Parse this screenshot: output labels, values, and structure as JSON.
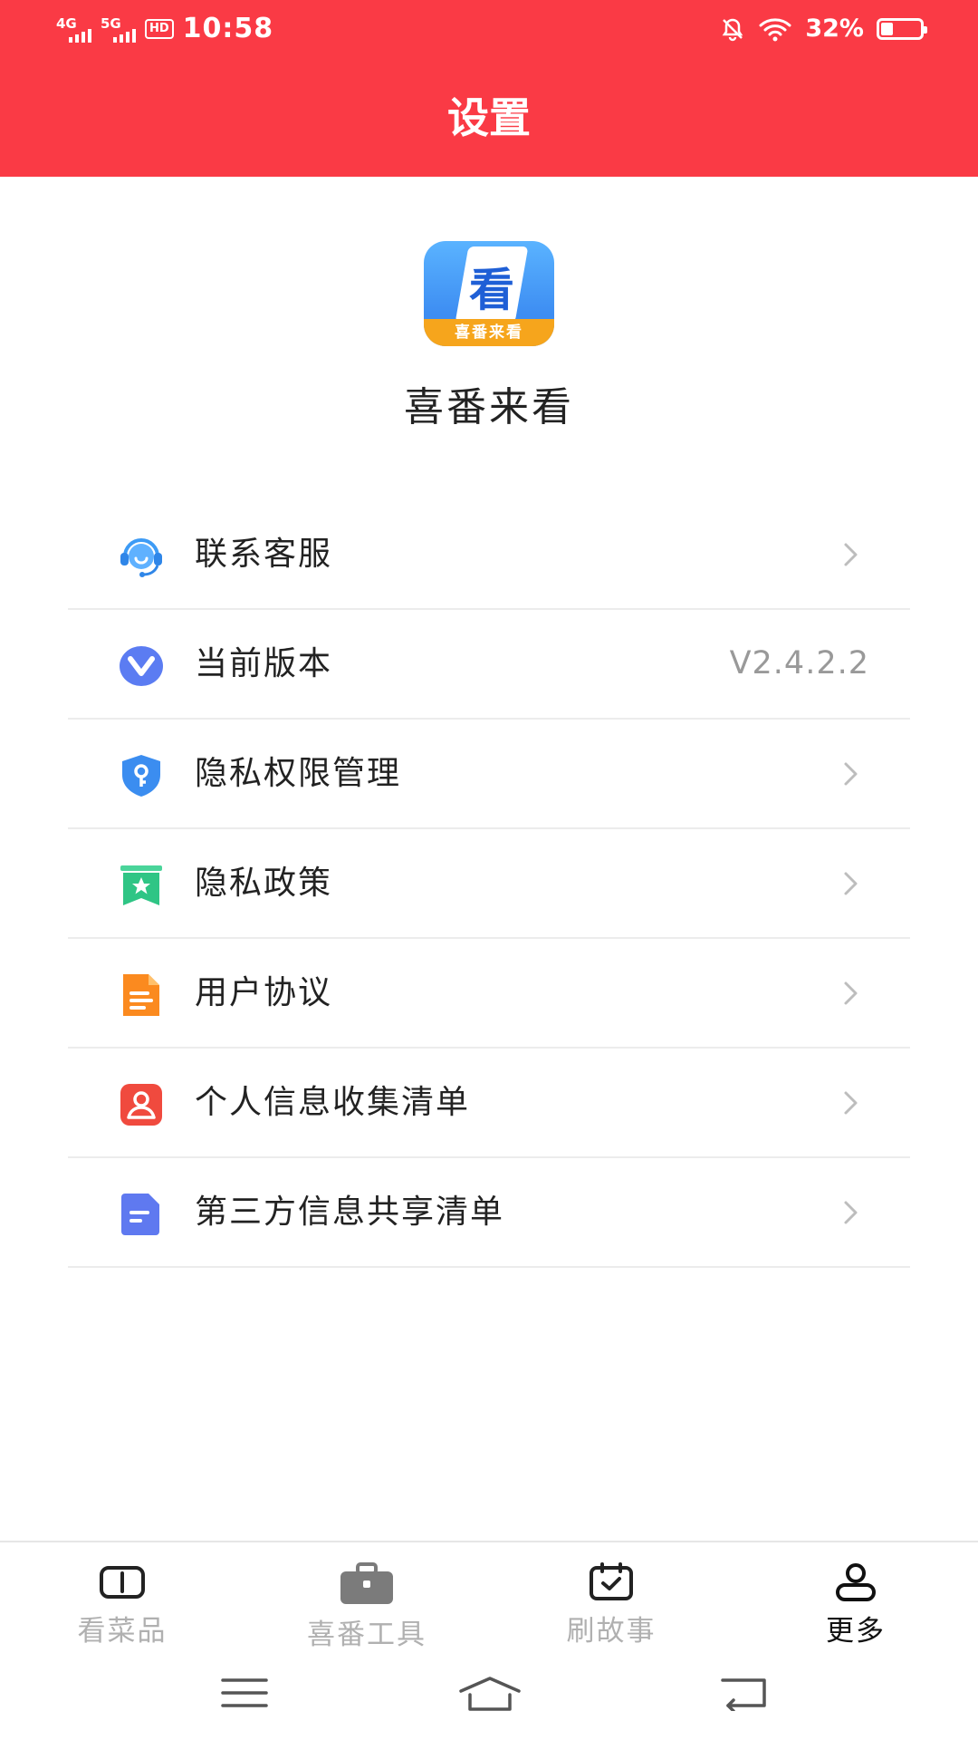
{
  "status_bar": {
    "network_1": "4G",
    "network_2": "5G",
    "hd_label": "HD",
    "time": "10:58",
    "battery_text": "32%",
    "battery_level": 0.32
  },
  "header": {
    "title": "设置"
  },
  "app": {
    "logo_glyph": "看",
    "logo_band_text": "喜番来看",
    "name": "喜番来看"
  },
  "settings": {
    "items": [
      {
        "label": "联系客服",
        "icon": "customer-service-icon"
      },
      {
        "label": "当前版本",
        "icon": "version-icon",
        "value": "V2.4.2.2"
      },
      {
        "label": "隐私权限管理",
        "icon": "privacy-shield-icon"
      },
      {
        "label": "隐私政策",
        "icon": "privacy-policy-icon"
      },
      {
        "label": "用户协议",
        "icon": "user-agreement-icon"
      },
      {
        "label": "个人信息收集清单",
        "icon": "personal-info-icon"
      },
      {
        "label": "第三方信息共享清单",
        "icon": "third-party-share-icon"
      }
    ]
  },
  "tabbar": {
    "tabs": [
      {
        "label": "看菜品",
        "icon": "book-icon"
      },
      {
        "label": "喜番工具",
        "icon": "toolbox-icon"
      },
      {
        "label": "刷故事",
        "icon": "calendar-check-icon"
      },
      {
        "label": "更多",
        "icon": "person-icon",
        "active": true
      }
    ]
  },
  "colors": {
    "header_bg": "#fa3a45",
    "text_primary": "#222222",
    "text_secondary": "#999999",
    "tab_inactive": "#b0b0b0",
    "tab_active": "#111111"
  }
}
